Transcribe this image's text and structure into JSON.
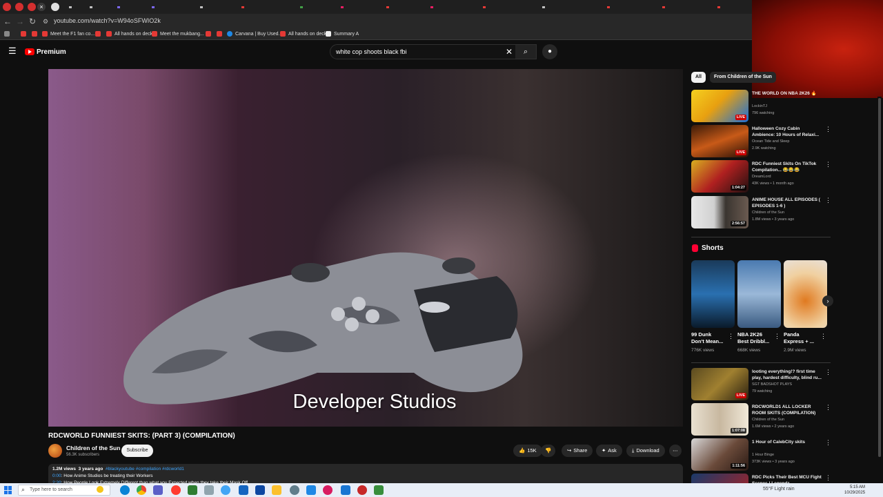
{
  "browser": {
    "url": "youtube.com/watch?v=W94oSFWIO2k",
    "bookmarks": [
      "Meet the F1 fan co...",
      "All hands on deck",
      "Meet the mukbang...",
      "Carvana | Buy Used...",
      "All hands on deck",
      "Summary A"
    ]
  },
  "yt": {
    "brand": "Premium",
    "search_query": "white cop shoots black fbi",
    "clear_icon": "✕",
    "search_icon": "⌕",
    "mic_icon": "●"
  },
  "player": {
    "caption": "Developer Studios"
  },
  "video": {
    "title": "RDCWORLD FUNNIEST SKITS: (PART 3) (COMPILATION)",
    "channel": "Children of the Sun",
    "subscribers": "56.3K subscribers",
    "subscribe_label": "Subscribe",
    "likes": "15K",
    "share_label": "Share",
    "ask_label": "Ask",
    "download_label": "Download",
    "more_icon": "⋯",
    "views": "1.2M views",
    "age": "3 years ago",
    "tags": "#blackyoutube #compilation #rdcworld1",
    "chapter1_time": "0:00",
    "chapter1_text": ": How Anime Studios be treating their Workers",
    "chapter2_time": "2:20",
    "chapter2_text": ": How People Look Extremely Different than what you Expected when they take their Mask Off"
  },
  "sidebar": {
    "chips": [
      "All",
      "From Children of the Sun"
    ],
    "recs": [
      {
        "title": "THE WORLD ON NBA 2K26 🔥",
        "channel": "LockinTJ",
        "meta": "796 watching",
        "badge": "LIVE",
        "live": true
      },
      {
        "title": "Halloween Cozy Cabin Ambience: 10 Hours of Relaxi...",
        "channel": "Ocean Tide and Sleep",
        "meta": "2.9K watching",
        "badge": "LIVE",
        "live": true
      },
      {
        "title": "RDC Funniest Skits On TikTok Compilation... 😂😂😂",
        "channel": "DreamLord",
        "meta": "43K views • 1 month ago",
        "badge": "1:04:27",
        "live": false
      },
      {
        "title": "ANIME HOUSE ALL EPISODES ( EPISODES 1-6 )",
        "channel": "Children of the Sun",
        "meta": "1.8M views • 3 years ago",
        "badge": "2:56:57",
        "live": false
      }
    ],
    "shorts_label": "Shorts",
    "shorts": [
      {
        "title": "99 Dunk Don't Mean...",
        "views": "776K views"
      },
      {
        "title": "NBA 2K26 Best Dribbl...",
        "views": "668K views"
      },
      {
        "title": "Panda Express + ...",
        "views": "2.9M views"
      }
    ],
    "recs2": [
      {
        "title": "looting everything!? first time play, hardest difficulty, blind ru...",
        "channel": "SGT BADSHOT PLAYS",
        "meta": "79 watching",
        "badge": "LIVE",
        "live": true
      },
      {
        "title": "RDCWORLD1 ALL LOCKER ROOM SKITS (COMPILATION)",
        "channel": "Children of the Sun",
        "meta": "1.6M views • 2 years ago",
        "badge": "1:07:08",
        "live": false
      },
      {
        "title": "1 Hour of CalebCity skits",
        "channel": "1 Hour Binge",
        "meta": "373K views • 3 years ago",
        "badge": "1:11:56",
        "live": false
      },
      {
        "title": "RDC Picks Their Best MCU Fight Scenes | Legendz...",
        "channel": "",
        "meta": "",
        "badge": "",
        "live": false
      }
    ]
  },
  "taskbar": {
    "search_placeholder": "Type here to search",
    "weather": "55°F  Light rain",
    "time": "5:15 AM",
    "date": "10/29/2025"
  },
  "colors": {
    "accent_red": "#ff0000",
    "link_blue": "#3ea6ff",
    "bg": "#0f0f0f"
  }
}
